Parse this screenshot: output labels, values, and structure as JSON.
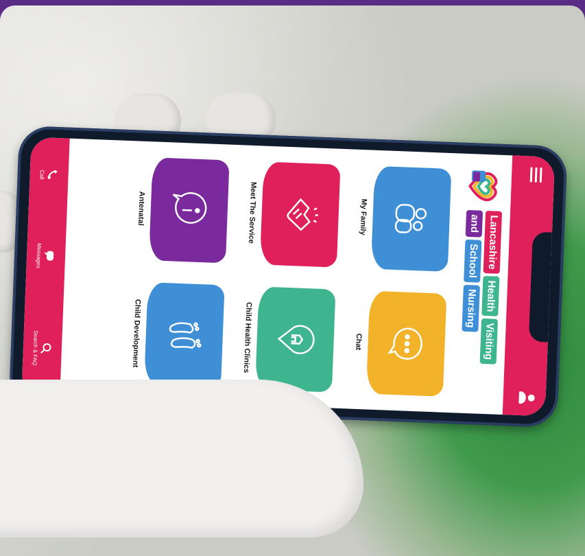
{
  "colors": {
    "frame": "#5b2c86",
    "app_bar": "#e0205a",
    "tile_my_family": "#3f8fd6",
    "tile_chat": "#f2b32a",
    "tile_meet_service": "#e0205a",
    "tile_child_health": "#3fb58f",
    "tile_antenatal": "#7a2a9c",
    "tile_child_dev": "#3f8fd6"
  },
  "header": {
    "menu_icon": "hamburger-icon",
    "profile_icon": "user-icon"
  },
  "logo": {
    "line1": [
      "Lancashire",
      "Health",
      "Visiting"
    ],
    "line2": [
      "and",
      "School",
      "Nursing"
    ]
  },
  "tiles": [
    {
      "label": "My Family",
      "icon": "family-icon"
    },
    {
      "label": "Chat",
      "icon": "chat-bubble-icon"
    },
    {
      "label": "Meet The Service",
      "icon": "handshake-icon"
    },
    {
      "label": "Child Health Clinics",
      "icon": "location-pin-icon"
    },
    {
      "label": "Antenatal",
      "icon": "info-icon"
    },
    {
      "label": "Child Development",
      "icon": "footprints-icon"
    }
  ],
  "bottom_nav": [
    {
      "label": "Call",
      "icon": "phone-icon"
    },
    {
      "label": "Messages",
      "icon": "message-icon"
    },
    {
      "label": "Search & FAQ",
      "icon": "search-icon"
    }
  ]
}
